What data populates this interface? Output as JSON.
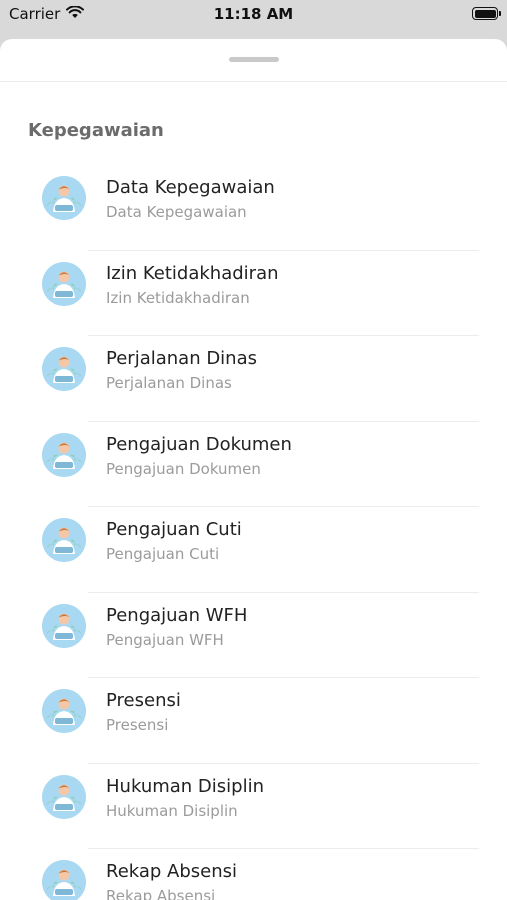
{
  "status_bar": {
    "carrier": "Carrier",
    "time": "11:18 AM"
  },
  "section": {
    "title": "Kepegawaian"
  },
  "items": [
    {
      "title": "Data Kepegawaian",
      "subtitle": "Data Kepegawaian"
    },
    {
      "title": "Izin Ketidakhadiran",
      "subtitle": "Izin Ketidakhadiran"
    },
    {
      "title": "Perjalanan Dinas",
      "subtitle": "Perjalanan Dinas"
    },
    {
      "title": "Pengajuan Dokumen",
      "subtitle": "Pengajuan Dokumen"
    },
    {
      "title": "Pengajuan Cuti",
      "subtitle": "Pengajuan Cuti"
    },
    {
      "title": "Pengajuan WFH",
      "subtitle": "Pengajuan WFH"
    },
    {
      "title": "Presensi",
      "subtitle": "Presensi"
    },
    {
      "title": "Hukuman Disiplin",
      "subtitle": "Hukuman Disiplin"
    },
    {
      "title": "Rekap Absensi",
      "subtitle": "Rekap Absensi"
    }
  ],
  "icons": {
    "wifi": "wifi-icon",
    "battery": "battery-icon",
    "avatar": "person-avatar-icon"
  },
  "colors": {
    "avatar_bg": "#a9d9f2",
    "title_text": "#222222",
    "subtitle_text": "#9b9b9b",
    "section_text": "#6b6b6b"
  }
}
